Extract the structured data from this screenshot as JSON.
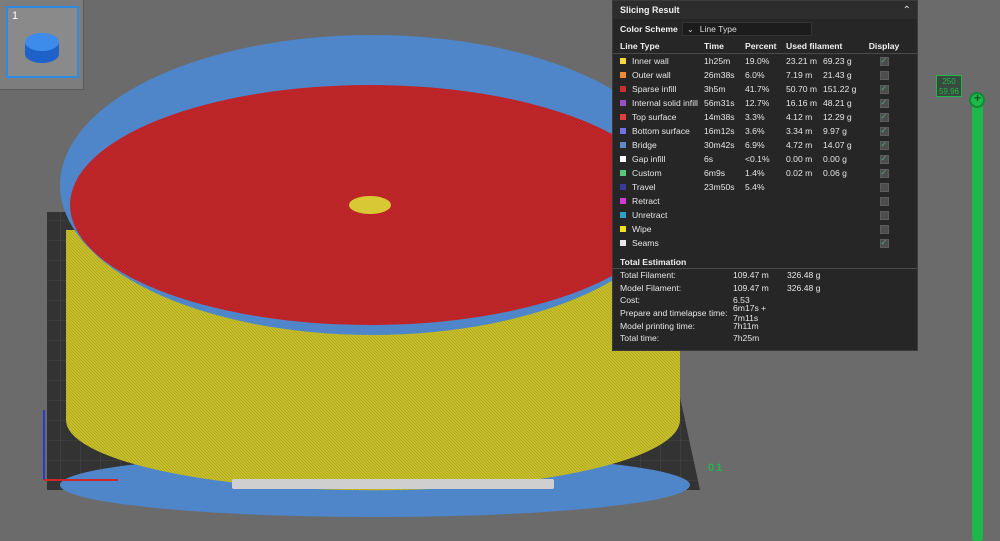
{
  "plate": {
    "number": "1"
  },
  "panel": {
    "title": "Slicing Result",
    "color_scheme_label": "Color Scheme",
    "color_scheme_value": "Line Type",
    "columns": [
      "Line Type",
      "Time",
      "Percent",
      "Used filament",
      "Display"
    ],
    "rows": [
      {
        "name": "Inner wall",
        "color": "#f5d740",
        "time": "1h25m",
        "pct": "19.0%",
        "len": "23.21 m",
        "g": "69.23 g",
        "on": true
      },
      {
        "name": "Outer wall",
        "color": "#f08a35",
        "time": "26m38s",
        "pct": "6.0%",
        "len": "7.19 m",
        "g": "21.43 g",
        "on": false
      },
      {
        "name": "Sparse infill",
        "color": "#c7302f",
        "time": "3h5m",
        "pct": "41.7%",
        "len": "50.70 m",
        "g": "151.22 g",
        "on": true
      },
      {
        "name": "Internal solid infill",
        "color": "#9a4fc9",
        "time": "56m31s",
        "pct": "12.7%",
        "len": "16.16 m",
        "g": "48.21 g",
        "on": true
      },
      {
        "name": "Top surface",
        "color": "#e33e3e",
        "time": "14m38s",
        "pct": "3.3%",
        "len": "4.12 m",
        "g": "12.29 g",
        "on": true
      },
      {
        "name": "Bottom surface",
        "color": "#7074e0",
        "time": "16m12s",
        "pct": "3.6%",
        "len": "3.34 m",
        "g": "9.97 g",
        "on": true
      },
      {
        "name": "Bridge",
        "color": "#5d8ac9",
        "time": "30m42s",
        "pct": "6.9%",
        "len": "4.72 m",
        "g": "14.07 g",
        "on": true
      },
      {
        "name": "Gap infill",
        "color": "#ffffff",
        "time": "6s",
        "pct": "<0.1%",
        "len": "0.00 m",
        "g": "0.00 g",
        "on": true
      },
      {
        "name": "Custom",
        "color": "#5ac87a",
        "time": "6m9s",
        "pct": "1.4%",
        "len": "0.02 m",
        "g": "0.06 g",
        "on": true
      },
      {
        "name": "Travel",
        "color": "#3a3a9a",
        "time": "23m50s",
        "pct": "5.4%",
        "len": "",
        "g": "",
        "on": false
      },
      {
        "name": "Retract",
        "color": "#d63ad6",
        "time": "",
        "pct": "",
        "len": "",
        "g": "",
        "on": false
      },
      {
        "name": "Unretract",
        "color": "#2ea0c9",
        "time": "",
        "pct": "",
        "len": "",
        "g": "",
        "on": false
      },
      {
        "name": "Wipe",
        "color": "#f5e020",
        "time": "",
        "pct": "",
        "len": "",
        "g": "",
        "on": false
      },
      {
        "name": "Seams",
        "color": "#e8e8e8",
        "time": "",
        "pct": "",
        "len": "",
        "g": "",
        "on": true
      }
    ],
    "total_title": "Total Estimation",
    "totals": [
      {
        "label": "Total Filament:",
        "v1": "109.47 m",
        "v2": "326.48 g"
      },
      {
        "label": "Model Filament:",
        "v1": "109.47 m",
        "v2": "326.48 g"
      },
      {
        "label": "Cost:",
        "v1": "6.53",
        "v2": ""
      },
      {
        "label": "Prepare and timelapse time:",
        "v1": "6m17s + 7m11s",
        "v2": ""
      },
      {
        "label": "Model printing time:",
        "v1": "7h11m",
        "v2": ""
      },
      {
        "label": "Total time:",
        "v1": "7h25m",
        "v2": ""
      }
    ]
  },
  "layer": {
    "top": "250",
    "height": "59.96",
    "bottom": "01"
  }
}
